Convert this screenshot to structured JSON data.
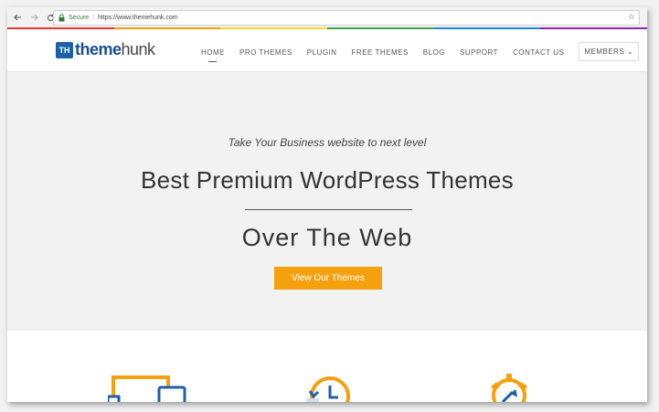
{
  "browser": {
    "secure_label": "Secure",
    "url": "https://www.themehunk.com"
  },
  "stripe_colors": [
    "#e53935",
    "#f5a00d",
    "#fdd835",
    "#43a047",
    "#1e88e5",
    "#8e24aa"
  ],
  "logo": {
    "badge": "TH",
    "part1": "theme",
    "part2": "hunk"
  },
  "nav": {
    "items": [
      "HOME",
      "PRO THEMES",
      "PLUGIN",
      "FREE THEMES",
      "BLOG",
      "SUPPORT",
      "CONTACT US"
    ],
    "members": "MEMBERS"
  },
  "hero": {
    "tagline": "Take Your Business website to next level",
    "headline": "Best Premium WordPress Themes",
    "subheadline": "Over The Web",
    "cta": "View Our Themes"
  },
  "colors": {
    "accent": "#f5a00d",
    "brand_blue": "#1d5fa8"
  },
  "features": {
    "icons": [
      "devices-icon",
      "history-clock-icon",
      "gear-wrench-icon"
    ]
  }
}
